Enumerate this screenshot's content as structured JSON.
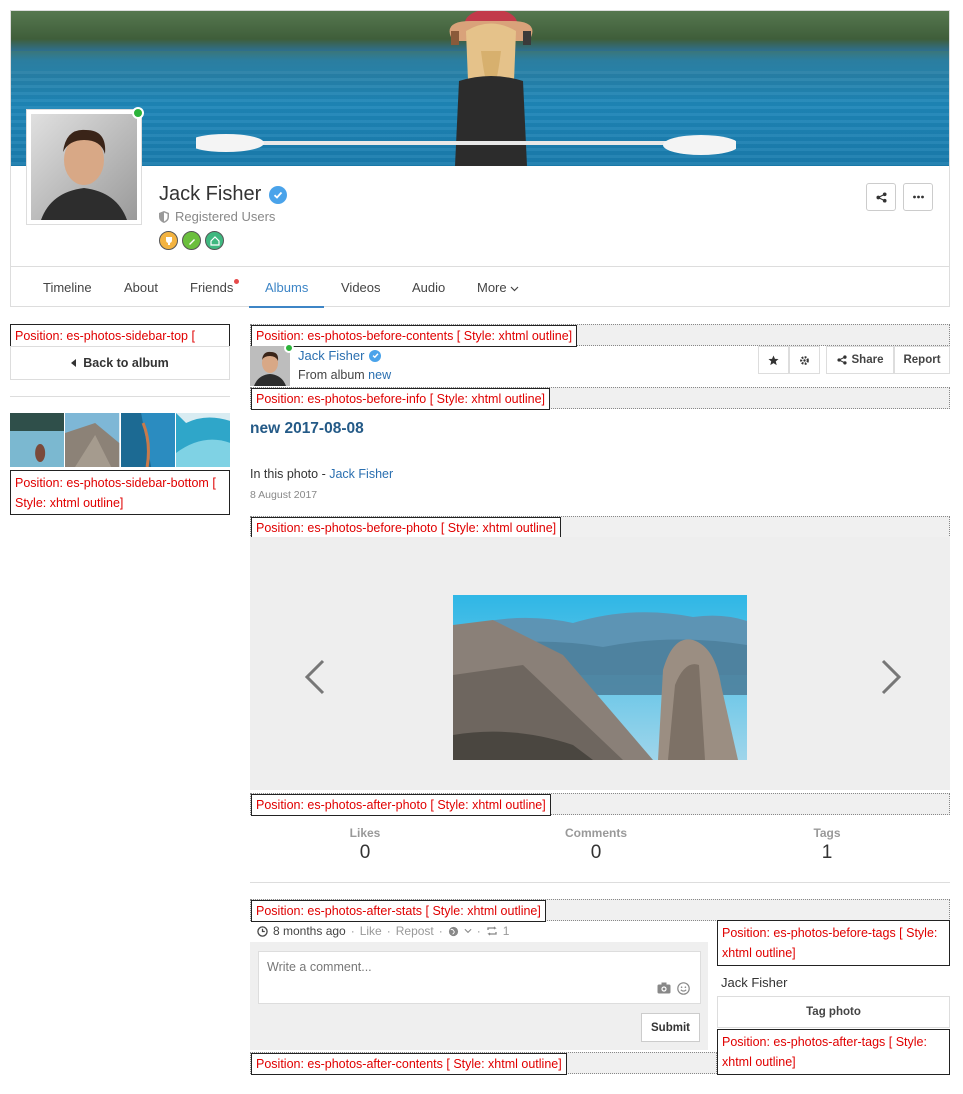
{
  "profile": {
    "name": "Jack Fisher",
    "role": "Registered Users",
    "header_buttons": [
      "share-icon",
      "more-icon"
    ]
  },
  "tabs": [
    {
      "label": "Timeline"
    },
    {
      "label": "About"
    },
    {
      "label": "Friends",
      "has_notification": true
    },
    {
      "label": "Albums",
      "active": true
    },
    {
      "label": "Videos"
    },
    {
      "label": "Audio"
    },
    {
      "label": "More"
    }
  ],
  "positions": {
    "sidebar_top": "Position: es-photos-sidebar-top [",
    "sidebar_bottom": "Position: es-photos-sidebar-bottom [ Style: xhtml outline]",
    "before_contents": "Position: es-photos-before-contents [ Style: xhtml outline]",
    "before_info": "Position: es-photos-before-info [ Style: xhtml outline]",
    "before_photo": "Position: es-photos-before-photo [ Style: xhtml outline]",
    "after_photo": "Position: es-photos-after-photo [ Style: xhtml outline]",
    "after_stats": "Position: es-photos-after-stats [ Style: xhtml outline]",
    "before_tags": "Position: es-photos-before-tags [ Style: xhtml outline]",
    "after_tags": "Position: es-photos-after-tags [ Style: xhtml outline]",
    "after_contents": "Position: es-photos-after-contents [ Style: xhtml outline]"
  },
  "sidebar": {
    "back_label": "Back to album"
  },
  "photo": {
    "author": "Jack Fisher",
    "from_album_prefix": "From album",
    "album_name": "new",
    "title": "new 2017-08-08",
    "in_photo_prefix": "In this photo -",
    "in_photo_person": "Jack Fisher",
    "date": "8 August 2017"
  },
  "actions": {
    "share_label": "Share",
    "report_label": "Report"
  },
  "stats": {
    "likes_label": "Likes",
    "likes_value": "0",
    "comments_label": "Comments",
    "comments_value": "0",
    "tags_label": "Tags",
    "tags_value": "1"
  },
  "meta": {
    "time": "8 months ago",
    "sep": "·",
    "like": "Like",
    "repost": "Repost",
    "repost_count": "1"
  },
  "comment": {
    "placeholder": "Write a comment...",
    "submit_label": "Submit"
  },
  "tags": {
    "tagged_name": "Jack Fisher",
    "tag_button_label": "Tag photo"
  },
  "colors": {
    "link": "#2a6fb0",
    "active_tab": "#3d85c6",
    "position_text": "#e00000",
    "online": "#2bb33a"
  }
}
